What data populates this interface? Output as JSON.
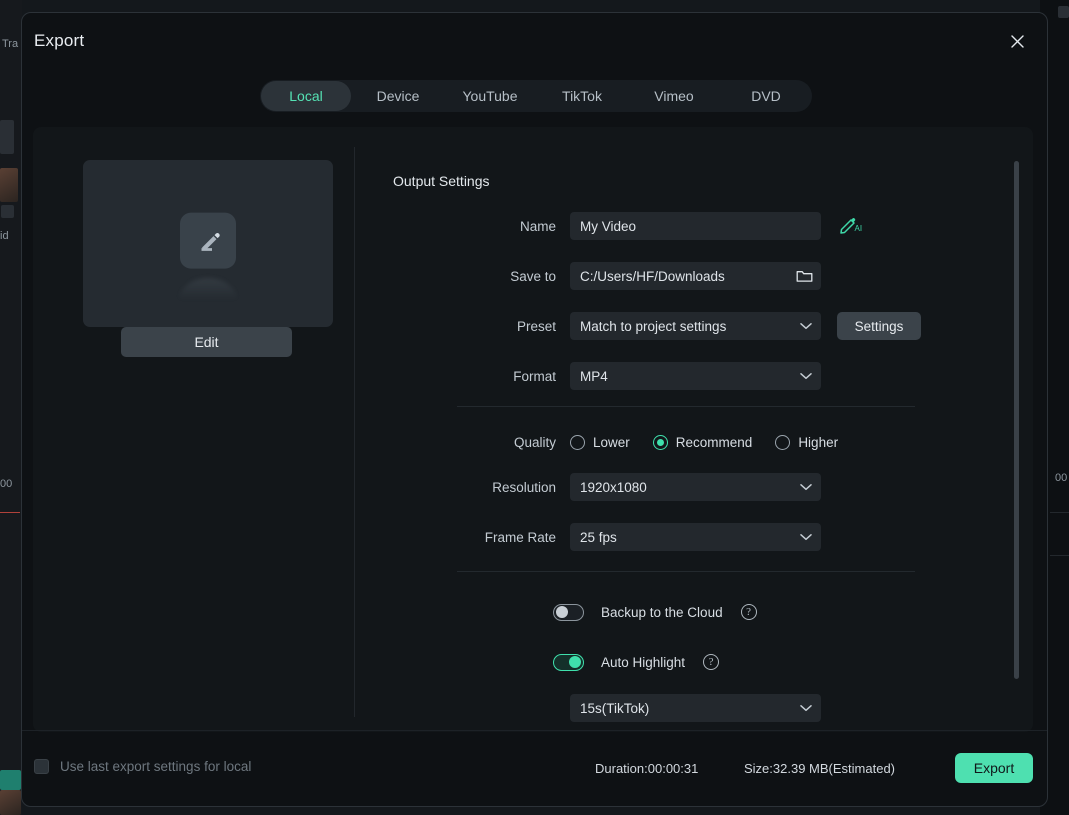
{
  "modal": {
    "title": "Export",
    "close_icon": "close-icon"
  },
  "tabs": [
    {
      "label": "Local",
      "active": true
    },
    {
      "label": "Device",
      "active": false
    },
    {
      "label": "YouTube",
      "active": false
    },
    {
      "label": "TikTok",
      "active": false
    },
    {
      "label": "Vimeo",
      "active": false
    },
    {
      "label": "DVD",
      "active": false
    }
  ],
  "preview": {
    "edit_label": "Edit",
    "thumb_icon": "edit-pencil-icon"
  },
  "output_settings": {
    "section_title": "Output Settings",
    "name": {
      "label": "Name",
      "value": "My Video",
      "placeholder": "My Video",
      "ai_icon": "ai-rename-icon"
    },
    "save_to": {
      "label": "Save to",
      "value": "C:/Users/HF/Downloads",
      "folder_icon": "folder-icon"
    },
    "preset": {
      "label": "Preset",
      "value": "Match to project settings",
      "settings_button": "Settings"
    },
    "format": {
      "label": "Format",
      "value": "MP4"
    }
  },
  "quality": {
    "label": "Quality",
    "options": [
      {
        "label": "Lower",
        "selected": false
      },
      {
        "label": "Recommend",
        "selected": true
      },
      {
        "label": "Higher",
        "selected": false
      }
    ],
    "resolution": {
      "label": "Resolution",
      "value": "1920x1080"
    },
    "frame_rate": {
      "label": "Frame Rate",
      "value": "25 fps"
    }
  },
  "extras": {
    "backup": {
      "label": "Backup to the Cloud",
      "enabled": false,
      "help_icon": "help-icon",
      "help_glyph": "?"
    },
    "auto_highlight": {
      "label": "Auto Highlight",
      "enabled": true,
      "help_icon": "help-icon",
      "help_glyph": "?"
    },
    "highlight_duration": {
      "value": "15s(TikTok)"
    }
  },
  "footer": {
    "use_last_label": "Use last export settings for local",
    "use_last_checked": false,
    "duration": "Duration:00:00:31",
    "size": "Size:32.39 MB(Estimated)",
    "export_label": "Export"
  },
  "colors": {
    "accent": "#4ee0b0",
    "accent_text": "#55e2b4",
    "panel": "#121619",
    "modal_bg": "#0e1114",
    "input_bg": "#23282d"
  },
  "background_app": {
    "label_transition": "Tra",
    "label_video": "id",
    "label_time": "00"
  }
}
